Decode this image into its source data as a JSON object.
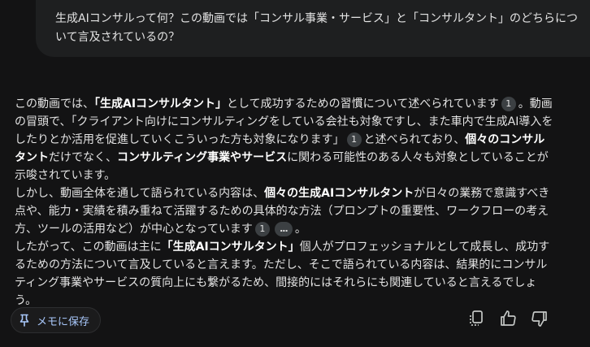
{
  "user_message": {
    "line1": "生成AIコンサルって何？この動画では「コンサル事業・サービス」と「コンサルタント」のどちらにつ",
    "line2": "いて言及されているの？"
  },
  "response": {
    "p1": {
      "t1": "この動画では、",
      "b1": "「生成AIコンサルタント」",
      "t2": "として成功するための習慣について述べられています",
      "c1": "1",
      "t3": "。動画の冒頭で、「クライアント向けにコンサルティングをしている会社も対象ですし、また車内で生成AI導入をしたりとか活用を促進していくこうい​った方も対象になります」",
      "c2": "1",
      "t4": "と述べられており、",
      "b2": "個々のコンサルタント",
      "t5": "だけでなく、",
      "b3": "コンサルティング事業やサービス",
      "t6": "に関わる可能性のある人々も対象としていることが示唆されています。"
    },
    "p2": {
      "t1": "しかし、動画全体を通して語られている内容は、",
      "b1": "個々の生成AIコンサルタント",
      "t2": "が日々の業務で意識すべき点や、能力・実績を積み重ねて活躍するための具体的な方法（プロンプトの重要性、ワークフローの考え方、ツールの活用など）が中心となっています",
      "c1": "1",
      "c2": "...",
      "t3": "。"
    },
    "p3": {
      "t1": "したがって、この動画は主に",
      "b1": "「生成AIコンサルタント」",
      "t2": "個人がプロフェッショナルとして成長し、成功するための方法について言及していると言えます。ただし、そこで語られている内容は、結果的にコンサルティング事業やサービスの質向上にも繋がるため、間接的にはそれらにも関連していると言えるでしょう。"
    }
  },
  "actions": {
    "save_to_memo_label": "メモに保存",
    "icons": [
      "pin-icon",
      "copy-icon",
      "thumbs-up-icon",
      "thumbs-down-icon"
    ]
  },
  "colors": {
    "background": "#131314",
    "bubble": "#1e1f20",
    "text": "#e3e3e3",
    "accent": "#a8c7fa",
    "citation_chip": "#3c4043"
  }
}
